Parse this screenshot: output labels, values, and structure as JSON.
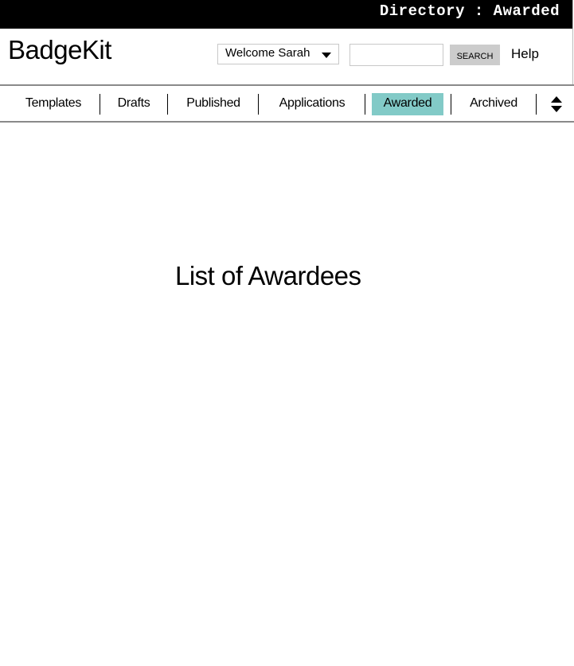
{
  "topbar": {
    "breadcrumb": "Directory : Awarded"
  },
  "header": {
    "logo": "BadgeKit",
    "user_menu_label": "Welcome Sarah",
    "search_value": "",
    "search_placeholder": "",
    "search_button": "SEARCH",
    "help_link": "Help"
  },
  "tabs": [
    {
      "label": "Templates",
      "active": false
    },
    {
      "label": "Drafts",
      "active": false
    },
    {
      "label": "Published",
      "active": false
    },
    {
      "label": "Applications",
      "active": false
    },
    {
      "label": "Awarded",
      "active": true
    },
    {
      "label": "Archived",
      "active": false
    }
  ],
  "colors": {
    "active_tab": "#82cac7",
    "topbar": "#000000",
    "search_button": "#cccccc"
  },
  "main": {
    "title": "List of Awardees"
  }
}
